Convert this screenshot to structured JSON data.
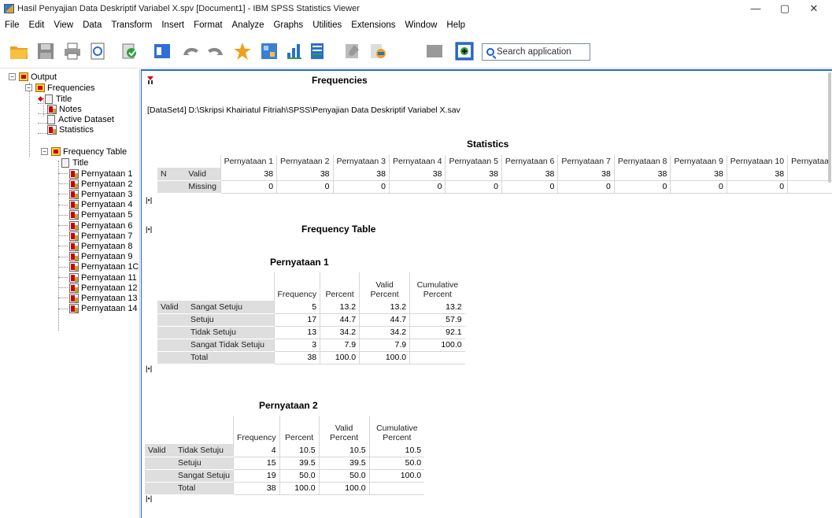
{
  "window": {
    "title": "Hasil Penyajian Data Deskriptif Variabel X.spv [Document1] - IBM SPSS Statistics Viewer",
    "minimize": "—",
    "restore": "▢",
    "close": "✕"
  },
  "menu": [
    "File",
    "Edit",
    "View",
    "Data",
    "Transform",
    "Insert",
    "Format",
    "Analyze",
    "Graphs",
    "Utilities",
    "Extensions",
    "Window",
    "Help"
  ],
  "search": {
    "placeholder": "Search application"
  },
  "toolbar_icons": [
    "open-icon",
    "save-icon",
    "print-icon",
    "print-preview-icon",
    "export-icon",
    "recall-dialog-icon",
    "undo-icon",
    "redo-icon",
    "goto-data-icon",
    "goto-case-icon",
    "variables-icon",
    "select-cases-icon",
    "show-all-icon",
    "insert-output-icon",
    "designate-window-icon",
    "promote-icon",
    "demote-icon"
  ],
  "tree": {
    "output": "Output",
    "frequencies": "Frequencies",
    "title": "Title",
    "notes": "Notes",
    "active_dataset": "Active Dataset",
    "statistics": "Statistics",
    "frequency_table": "Frequency Table",
    "ft_title": "Title",
    "items": [
      "Pernyataan 1",
      "Pernyataan 2",
      "Pernyataan 3",
      "Pernyataan 4",
      "Pernyataan 5",
      "Pernyataan 6",
      "Pernyataan 7",
      "Pernyataan 8",
      "Pernyataan 9",
      "Pernyataan 1C",
      "Pernyataan 11",
      "Pernyataan 12",
      "Pernyataan 13",
      "Pernyataan 14"
    ]
  },
  "viewer": {
    "heading": "Frequencies",
    "dataset": "[DataSet4] D:\\Skripsi Khairiatul Fitriah\\SPSS\\Penyajian Data Deskriptif Variabel X.sav",
    "stats_title": "Statistics",
    "stats_cols": [
      "Pernyataan 1",
      "Pernyataan 2",
      "Pernyataan 3",
      "Pernyataan 4",
      "Pernyataan 5",
      "Pernyataan 6",
      "Pernyataan 7",
      "Pernyataan 8",
      "Pernyataan 9",
      "Pernyataan 10",
      "Pernyataa"
    ],
    "stats_n": "N",
    "stats_valid": "Valid",
    "stats_missing": "Missing",
    "stats_valid_values": [
      "38",
      "38",
      "38",
      "38",
      "38",
      "38",
      "38",
      "38",
      "38",
      "38",
      ""
    ],
    "stats_missing_values": [
      "0",
      "0",
      "0",
      "0",
      "0",
      "0",
      "0",
      "0",
      "0",
      "0",
      ""
    ],
    "freq_heading": "Frequency Table",
    "table1": {
      "title": "Pernyataan 1",
      "headers": [
        "Frequency",
        "Percent",
        "Valid Percent",
        "Cumulative Percent"
      ],
      "group": "Valid",
      "rows": [
        {
          "label": "Sangat Setuju",
          "f": "5",
          "p": "13.2",
          "vp": "13.2",
          "cp": "13.2"
        },
        {
          "label": "Setuju",
          "f": "17",
          "p": "44.7",
          "vp": "44.7",
          "cp": "57.9"
        },
        {
          "label": "Tidak Setuju",
          "f": "13",
          "p": "34.2",
          "vp": "34.2",
          "cp": "92.1"
        },
        {
          "label": "Sangat Tidak Setuju",
          "f": "3",
          "p": "7.9",
          "vp": "7.9",
          "cp": "100.0"
        },
        {
          "label": "Total",
          "f": "38",
          "p": "100.0",
          "vp": "100.0",
          "cp": ""
        }
      ]
    },
    "table2": {
      "title": "Pernyataan 2",
      "headers": [
        "Frequency",
        "Percent",
        "Valid Percent",
        "Cumulative Percent"
      ],
      "group": "Valid",
      "rows": [
        {
          "label": "Tidak Setuju",
          "f": "4",
          "p": "10.5",
          "vp": "10.5",
          "cp": "10.5"
        },
        {
          "label": "Setuju",
          "f": "15",
          "p": "39.5",
          "vp": "39.5",
          "cp": "50.0"
        },
        {
          "label": "Sangat Setuju",
          "f": "19",
          "p": "50.0",
          "vp": "50.0",
          "cp": "100.0"
        },
        {
          "label": "Total",
          "f": "38",
          "p": "100.0",
          "vp": "100.0",
          "cp": ""
        }
      ]
    }
  }
}
